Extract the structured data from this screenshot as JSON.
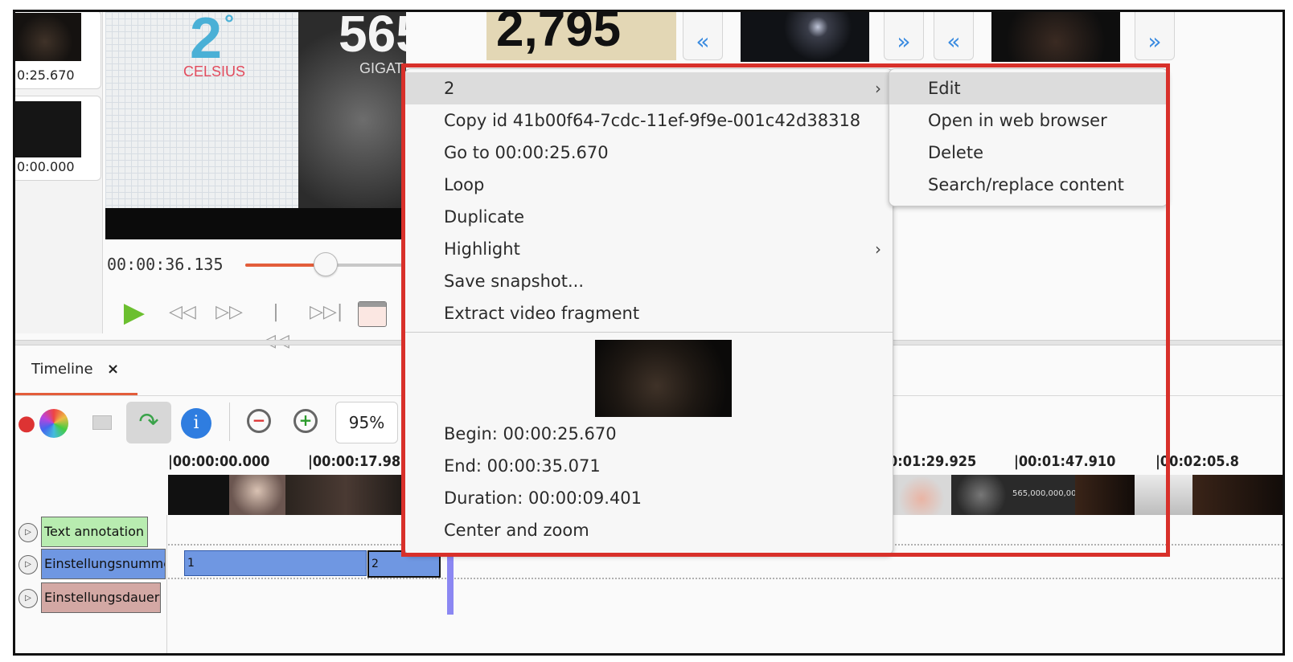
{
  "annotations_list": [
    {
      "time": "0:25.670"
    },
    {
      "time": "0:00.000"
    }
  ],
  "video": {
    "celsius_value": "2",
    "celsius_degree": "°",
    "celsius_label": "CELSIUS",
    "gigatons_value": "565",
    "gigatons_label": "GIGAT",
    "number_2795": "2,795"
  },
  "player": {
    "timecode": "00:00:36.135",
    "position_fraction": 0.5
  },
  "timeline": {
    "tab_label": "Timeline",
    "tab_close": "×",
    "zoom": "95%",
    "ruler": [
      "|00:00:00.000",
      "|00:00:17.98",
      "0:01:29.925",
      "|00:01:47.910",
      "|00:02:05.8"
    ],
    "strip_text": "565,000,000,00",
    "tracks": [
      {
        "name": "Text annotation",
        "color": "#b8ecb0"
      },
      {
        "name": "Einstellungsnumme",
        "color": "#6f97e2"
      },
      {
        "name": "Einstellungsdauer",
        "color": "#d3a8a4"
      }
    ],
    "segments": [
      "1",
      "2"
    ]
  },
  "context_menu": {
    "header": "2",
    "items": [
      "Copy id 41b00f64-7cdc-11ef-9f9e-001c42d38318",
      "Go to 00:00:25.670",
      "Loop",
      "Duplicate",
      "Highlight",
      "Save snapshot...",
      "Extract video fragment"
    ],
    "info": [
      "Begin: 00:00:25.670",
      "End: 00:00:35.071",
      "Duration: 00:00:09.401",
      "Center and zoom"
    ],
    "arrow": "›"
  },
  "submenu": {
    "items": [
      "Edit",
      "Open in web browser",
      "Delete",
      "Search/replace content"
    ]
  },
  "colors": {
    "accent": "#e35d3a",
    "highlight_box": "#d8302a",
    "playhead": "#8b87f2"
  }
}
